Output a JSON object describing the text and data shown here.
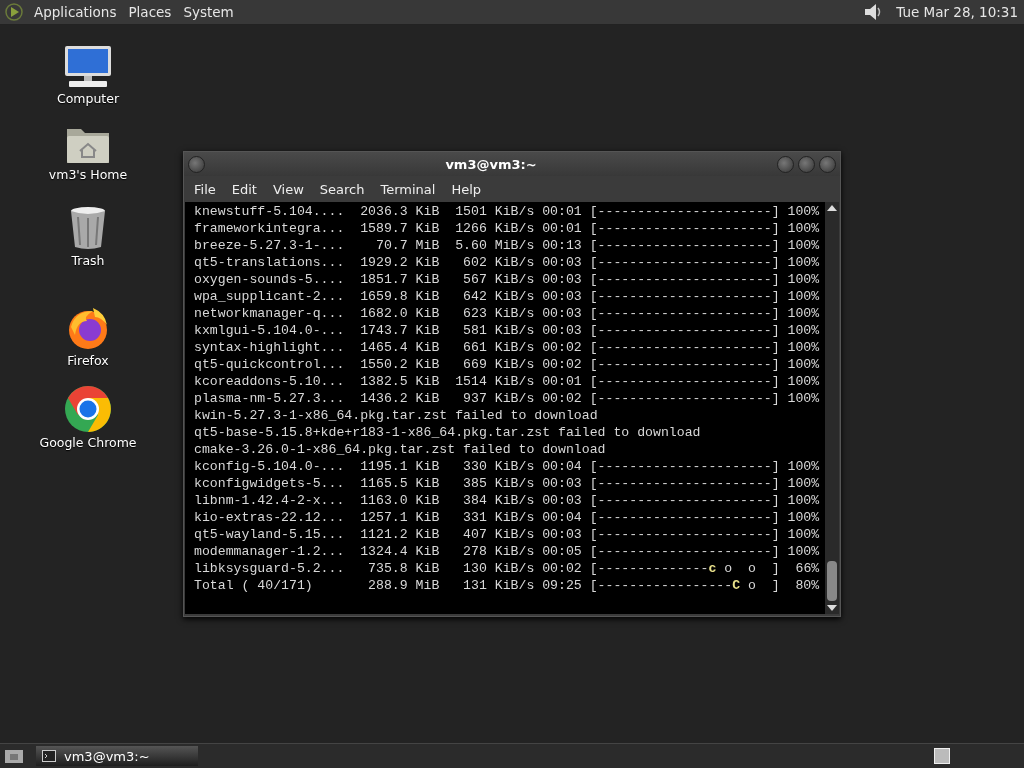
{
  "top_panel": {
    "menus": [
      "Applications",
      "Places",
      "System"
    ],
    "clock": "Tue Mar 28, 10:31"
  },
  "desktop_icons": [
    {
      "kind": "computer",
      "label": "Computer"
    },
    {
      "kind": "home",
      "label": "vm3's Home"
    },
    {
      "kind": "trash",
      "label": "Trash"
    },
    {
      "kind": "firefox",
      "label": "Firefox"
    },
    {
      "kind": "chrome",
      "label": "Google Chrome"
    }
  ],
  "terminal": {
    "title": "vm3@vm3:~",
    "menu": [
      "File",
      "Edit",
      "View",
      "Search",
      "Terminal",
      "Help"
    ],
    "lines": [
      {
        "kind": "plain",
        "text": "knewstuff-5.104....  2036.3 KiB  1501 KiB/s 00:01 [----------------------] 100%"
      },
      {
        "kind": "plain",
        "text": "frameworkintegra...  1589.7 KiB  1266 KiB/s 00:01 [----------------------] 100%"
      },
      {
        "kind": "plain",
        "text": "breeze-5.27.3-1-...    70.7 MiB  5.60 MiB/s 00:13 [----------------------] 100%"
      },
      {
        "kind": "plain",
        "text": "qt5-translations...  1929.2 KiB   602 KiB/s 00:03 [----------------------] 100%"
      },
      {
        "kind": "plain",
        "text": "oxygen-sounds-5....  1851.7 KiB   567 KiB/s 00:03 [----------------------] 100%"
      },
      {
        "kind": "plain",
        "text": "wpa_supplicant-2...  1659.8 KiB   642 KiB/s 00:03 [----------------------] 100%"
      },
      {
        "kind": "plain",
        "text": "networkmanager-q...  1682.0 KiB   623 KiB/s 00:03 [----------------------] 100%"
      },
      {
        "kind": "plain",
        "text": "kxmlgui-5.104.0-...  1743.7 KiB   581 KiB/s 00:03 [----------------------] 100%"
      },
      {
        "kind": "plain",
        "text": "syntax-highlight...  1465.4 KiB   661 KiB/s 00:02 [----------------------] 100%"
      },
      {
        "kind": "plain",
        "text": "qt5-quickcontrol...  1550.2 KiB   669 KiB/s 00:02 [----------------------] 100%"
      },
      {
        "kind": "plain",
        "text": "kcoreaddons-5.10...  1382.5 KiB  1514 KiB/s 00:01 [----------------------] 100%"
      },
      {
        "kind": "plain",
        "text": "plasma-nm-5.27.3...  1436.2 KiB   937 KiB/s 00:02 [----------------------] 100%"
      },
      {
        "kind": "plain",
        "text": "kwin-5.27.3-1-x86_64.pkg.tar.zst failed to download"
      },
      {
        "kind": "plain",
        "text": "qt5-base-5.15.8+kde+r183-1-x86_64.pkg.tar.zst failed to download"
      },
      {
        "kind": "plain",
        "text": "cmake-3.26.0-1-x86_64.pkg.tar.zst failed to download"
      },
      {
        "kind": "plain",
        "text": "kconfig-5.104.0-...  1195.1 KiB   330 KiB/s 00:04 [----------------------] 100%"
      },
      {
        "kind": "plain",
        "text": "kconfigwidgets-5...  1165.5 KiB   385 KiB/s 00:03 [----------------------] 100%"
      },
      {
        "kind": "plain",
        "text": "libnm-1.42.4-2-x...  1163.0 KiB   384 KiB/s 00:03 [----------------------] 100%"
      },
      {
        "kind": "plain",
        "text": "kio-extras-22.12...  1257.1 KiB   331 KiB/s 00:04 [----------------------] 100%"
      },
      {
        "kind": "plain",
        "text": "qt5-wayland-5.15...  1121.2 KiB   407 KiB/s 00:03 [----------------------] 100%"
      },
      {
        "kind": "plain",
        "text": "modemmanager-1.2...  1324.4 KiB   278 KiB/s 00:05 [----------------------] 100%"
      },
      {
        "kind": "pacman",
        "before": "libksysguard-5.2...   735.8 KiB   130 KiB/s 00:02 [--------------",
        "pac": "c",
        "after": " o  o  ]  66%"
      },
      {
        "kind": "pacman",
        "before": "Total ( 40/171)       288.9 MiB   131 KiB/s 09:25 [-----------------",
        "pac": "C",
        "after": " o  ]  80%"
      }
    ]
  },
  "taskbar": {
    "tasks": [
      {
        "label": "vm3@vm3:~",
        "selected": true
      }
    ]
  }
}
